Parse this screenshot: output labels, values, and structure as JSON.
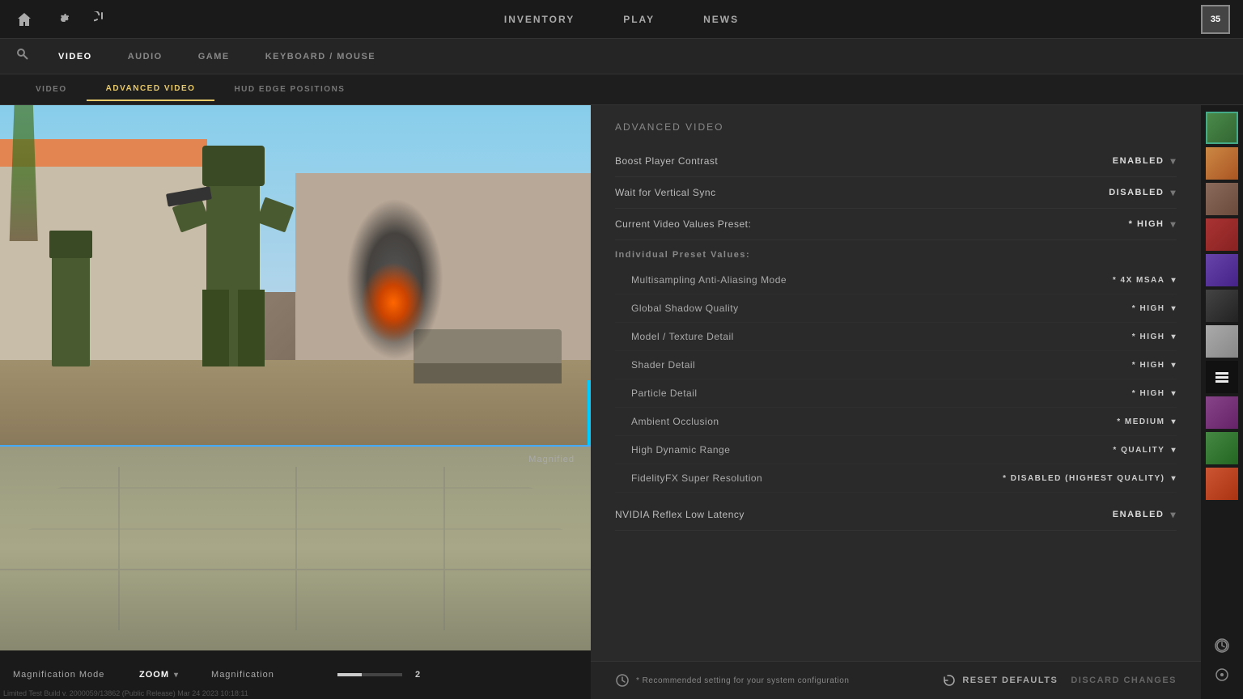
{
  "topNav": {
    "links": [
      {
        "id": "inventory",
        "label": "INVENTORY"
      },
      {
        "id": "play",
        "label": "PLAY"
      },
      {
        "id": "news",
        "label": "NEWS"
      }
    ],
    "level": "35"
  },
  "settingsTabs": {
    "tabs": [
      {
        "id": "video",
        "label": "VIDEO"
      },
      {
        "id": "audio",
        "label": "AUDIO"
      },
      {
        "id": "game",
        "label": "GAME"
      },
      {
        "id": "keyboard-mouse",
        "label": "KEYBOARD / MOUSE"
      }
    ],
    "activeTab": "video"
  },
  "subTabs": {
    "tabs": [
      {
        "id": "video",
        "label": "VIDEO"
      },
      {
        "id": "advanced-video",
        "label": "ADVANCED VIDEO"
      },
      {
        "id": "hud-edge",
        "label": "HUD EDGE POSITIONS"
      }
    ],
    "activeTab": "advanced-video"
  },
  "advancedVideo": {
    "sectionTitle": "Advanced Video",
    "settings": [
      {
        "id": "boost-player-contrast",
        "label": "Boost Player Contrast",
        "value": "ENABLED"
      },
      {
        "id": "wait-for-vsync",
        "label": "Wait for Vertical Sync",
        "value": "DISABLED"
      },
      {
        "id": "current-preset",
        "label": "Current Video Values Preset:",
        "value": "* HIGH"
      }
    ],
    "presetSection": {
      "title": "Individual Preset Values:",
      "items": [
        {
          "id": "msaa",
          "label": "Multisampling Anti-Aliasing Mode",
          "value": "* 4X MSAA"
        },
        {
          "id": "shadow-quality",
          "label": "Global Shadow Quality",
          "value": "* HIGH"
        },
        {
          "id": "model-texture",
          "label": "Model / Texture Detail",
          "value": "* HIGH"
        },
        {
          "id": "shader-detail",
          "label": "Shader Detail",
          "value": "* HIGH"
        },
        {
          "id": "particle-detail",
          "label": "Particle Detail",
          "value": "* HIGH"
        },
        {
          "id": "ambient-occlusion",
          "label": "Ambient Occlusion",
          "value": "* MEDIUM"
        },
        {
          "id": "hdr",
          "label": "High Dynamic Range",
          "value": "* QUALITY"
        },
        {
          "id": "fidelityfx",
          "label": "FidelityFX Super Resolution",
          "value": "* DISABLED (HIGHEST QUALITY)"
        }
      ]
    },
    "nvidiaReflex": {
      "label": "NVIDIA Reflex Low Latency",
      "value": "ENABLED"
    }
  },
  "footer": {
    "recommendedNote": "* Recommended setting for your system configuration",
    "resetLabel": "RESET DEFAULTS",
    "discardLabel": "DISCARD CHANGES"
  },
  "leftPanel": {
    "magnificationMode": {
      "label": "Magnification Mode",
      "value": "ZOOM"
    },
    "magnification": {
      "label": "Magnification",
      "value": "2"
    },
    "magnifiedLabel": "Magnified",
    "buildInfo": "Limited Test Build v. 2000059/13862 (Public Release) Mar 24 2023 10:18:11"
  },
  "avatarColors": [
    "#4a8a4a",
    "#cc6633",
    "#3366aa",
    "#aa3333",
    "#6644aa",
    "#44aaaa",
    "#aa8833",
    "#cccccc",
    "#333333",
    "#884488",
    "#448844",
    "#aa4422"
  ]
}
